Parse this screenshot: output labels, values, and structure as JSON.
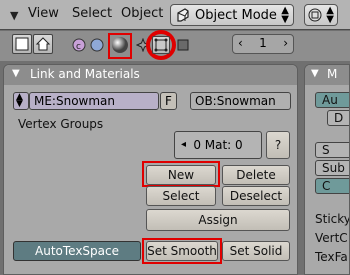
{
  "header": {
    "menus": [
      "View",
      "Select",
      "Object"
    ],
    "mode_select": "Object Mode",
    "layer_page": "1",
    "colors": {
      "highlight": "#e00000",
      "pager_arrows": [
        "‹",
        "›"
      ]
    }
  },
  "panel": {
    "title": "Link and Materials",
    "mesh_name": "ME:Snowman",
    "fake_user": "F",
    "object_name": "OB:Snowman",
    "vertex_groups_label": "Vertex Groups",
    "material_indicator": "0 Mat: 0",
    "help_button": "?",
    "new_button": "New",
    "delete_button": "Delete",
    "select_button": "Select",
    "deselect_button": "Deselect",
    "assign_button": "Assign",
    "autotexspace_button": "AutoTexSpace",
    "set_smooth_button": "Set Smooth",
    "set_solid_button": "Set Solid"
  },
  "panel2": {
    "title_partial": "M",
    "rows": [
      "Au",
      "D",
      "S",
      "Sub",
      "C"
    ],
    "labels": [
      "Sticky",
      "VertC",
      "TexFa"
    ]
  },
  "icons": {
    "toolbar": [
      "window-icon",
      "home-icon",
      "material-icon",
      "sphere-shading-icon",
      "particle-icon",
      "editing-icon",
      "scene-icon"
    ]
  }
}
